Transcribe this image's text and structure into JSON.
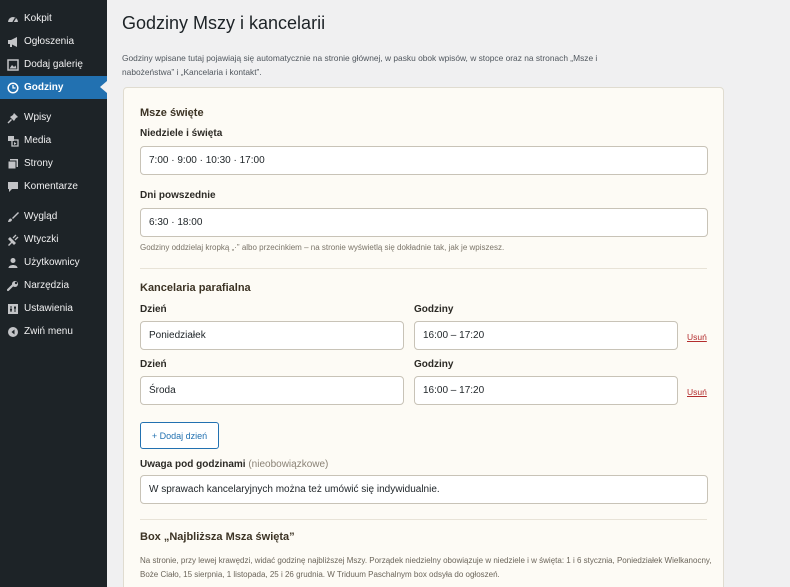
{
  "sidebar": {
    "items": [
      {
        "label": "Kokpit",
        "icon": "dashboard-icon"
      },
      {
        "label": "Ogłoszenia",
        "icon": "megaphone-icon"
      },
      {
        "label": "Dodaj galerię",
        "icon": "gallery-icon"
      },
      {
        "label": "Godziny",
        "icon": "clock-icon"
      },
      {
        "label": "Wpisy",
        "icon": "pin-icon"
      },
      {
        "label": "Media",
        "icon": "media-icon"
      },
      {
        "label": "Strony",
        "icon": "pages-icon"
      },
      {
        "label": "Komentarze",
        "icon": "comment-icon"
      },
      {
        "label": "Wygląd",
        "icon": "brush-icon"
      },
      {
        "label": "Wtyczki",
        "icon": "plugin-icon"
      },
      {
        "label": "Użytkownicy",
        "icon": "users-icon"
      },
      {
        "label": "Narzędzia",
        "icon": "wrench-icon"
      },
      {
        "label": "Ustawienia",
        "icon": "settings-icon"
      },
      {
        "label": "Zwiń menu",
        "icon": "collapse-icon"
      }
    ],
    "active_index": 3,
    "colors": {
      "background": "#1d2327",
      "active": "#2271b1",
      "text": "#f0f0f1"
    }
  },
  "page": {
    "title": "Godziny Mszy i kancelarii",
    "description": "Godziny wpisane tutaj pojawiają się automatycznie na stronie głównej, w pasku obok wpisów, w stopce oraz na stronach „Msze i nabożeństwa” i „Kancelaria i kontakt”."
  },
  "masses": {
    "title": "Msze święte",
    "sunday_label": "Niedziele i święta",
    "sunday_value": "7:00 · 9:00 · 10:30 · 17:00",
    "weekday_label": "Dni powszednie",
    "weekday_value": "6:30 · 18:00",
    "hint": "Godziny oddzielaj kropką „·” albo przecinkiem – na stronie wyświetlą się dokładnie tak, jak je wpiszesz."
  },
  "office": {
    "title": "Kancelaria parafialna",
    "day_label": "Dzień",
    "hours_label": "Godziny",
    "delete_label": "Usuń",
    "rows": [
      {
        "day": "Poniedziałek",
        "hours": "16:00 – 17:20"
      },
      {
        "day": "Środa",
        "hours": "16:00 – 17:20"
      }
    ],
    "add_label": "+ Dodaj dzień",
    "note_label": "Uwaga pod godzinami",
    "note_optional": "(nieobowiązkowe)",
    "note_value": "W sprawach kancelaryjnych można też umówić się indywidualnie."
  },
  "box": {
    "title": "Box „Najbliższa Msza święta”",
    "description": "Na stronie, przy lewej krawędzi, widać godzinę najbliższej Mszy. Porządek niedzielny obowiązuje w niedziele i w święta: 1 i 6 stycznia, Poniedziałek Wielkanocny, Boże Ciało, 15 sierpnia, 1 listopada, 25 i 26 grudnia. W Triduum Paschalnym box odsyła do ogłoszeń."
  }
}
